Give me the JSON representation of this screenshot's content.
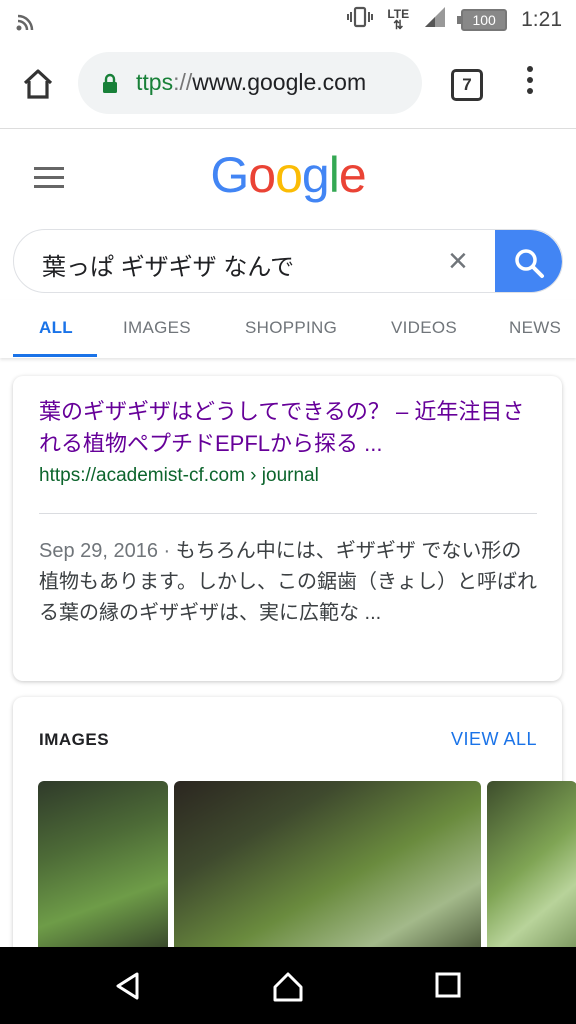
{
  "status_bar": {
    "battery": "100",
    "time": "1:21",
    "network": "LTE"
  },
  "toolbar": {
    "url_protocol": "ttps",
    "url_sep": "://",
    "url_host": "www.google.com",
    "tab_count": "7"
  },
  "logo": {
    "letters": [
      "G",
      "o",
      "o",
      "g",
      "l",
      "e"
    ],
    "colors": [
      "#4285f4",
      "#ea4335",
      "#fbbc05",
      "#4285f4",
      "#34a853",
      "#ea4335"
    ]
  },
  "search": {
    "query": "葉っぱ ギザギザ なんで",
    "clear_glyph": "×"
  },
  "tabs": [
    {
      "label": "ALL",
      "active": true
    },
    {
      "label": "IMAGES",
      "active": false
    },
    {
      "label": "SHOPPING",
      "active": false
    },
    {
      "label": "VIDEOS",
      "active": false
    },
    {
      "label": "NEWS",
      "active": false
    }
  ],
  "result": {
    "title": "葉のギザギザはどうしてできるの？ – 近年注目される植物ペプチドEPFLから探る ...",
    "url": "https://academist-cf.com › journal",
    "date": "Sep 29, 2016 · ",
    "snippet": "もちろん中には、ギザギザ でない形の植物もあります。しかし、この鋸歯（きょし）と呼ばれる葉の縁のギザギザは、実に広範な ..."
  },
  "images_section": {
    "title": "IMAGES",
    "view_all": "VIEW ALL"
  },
  "colors": {
    "accent": "#1a73e8",
    "visited_link": "#660099",
    "url_green": "#0d652d",
    "search_button": "#4285f4"
  }
}
